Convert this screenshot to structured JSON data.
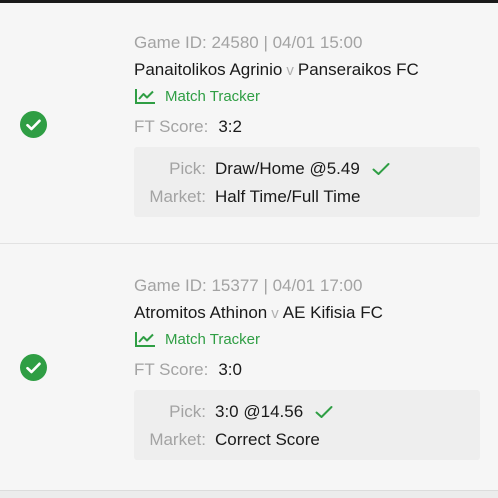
{
  "bets": [
    {
      "game_line": "Game ID: 24580 | 04/01 15:00",
      "home_team": "Panaitolikos Agrinio",
      "vs_label": "v",
      "away_team": "Panseraikos FC",
      "tracker_label": "Match Tracker",
      "ft_score_label": "FT Score:",
      "ft_score": "3:2",
      "pick_label": "Pick:",
      "pick_value": "Draw/Home @5.49",
      "market_label": "Market:",
      "market_value": "Half Time/Full Time",
      "status": "won"
    },
    {
      "game_line": "Game ID: 15377 | 04/01 17:00",
      "home_team": "Atromitos Athinon",
      "vs_label": "v",
      "away_team": "AE Kifisia FC",
      "tracker_label": "Match Tracker",
      "ft_score_label": "FT Score:",
      "ft_score": "3:0",
      "pick_label": "Pick:",
      "pick_value": "3:0 @14.56",
      "market_label": "Market:",
      "market_value": "Correct Score",
      "status": "won"
    }
  ],
  "colors": {
    "accent_green": "#2f9e44",
    "muted_text": "#a3a3a3",
    "primary_text": "#1a1a1a",
    "pick_box_bg": "#eeeeee"
  },
  "icons": {
    "status": "check-circle-icon",
    "tracker": "line-chart-icon",
    "pick_result": "checkmark-icon"
  }
}
